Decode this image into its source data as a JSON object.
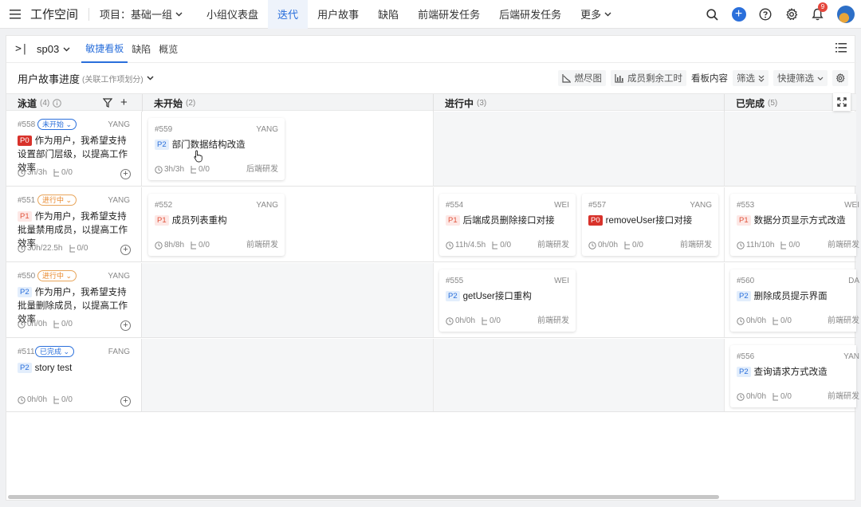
{
  "nav": {
    "workspace": "工作空间",
    "project": "项目：基础一组",
    "tabs": [
      {
        "label": "小组仪表盘"
      },
      {
        "label": "迭代"
      },
      {
        "label": "用户故事"
      },
      {
        "label": "缺陷"
      },
      {
        "label": "前端研发任务"
      },
      {
        "label": "后端研发任务"
      },
      {
        "label": "更多"
      }
    ],
    "active_tab": "迭代",
    "notification_count": "9"
  },
  "subbar": {
    "sprint": "sp03",
    "tabs": [
      {
        "label": "敏捷看板"
      },
      {
        "label": "缺陷"
      },
      {
        "label": "概览"
      }
    ],
    "active_tab": "敏捷看板"
  },
  "toolbar": {
    "title": "用户故事进度",
    "subtitle": "(关联工作项划分)",
    "burndown": "燃尽图",
    "remaining": "成员剩余工时",
    "board_content": "看板内容",
    "filter": "筛选",
    "quick_filter": "快捷筛选"
  },
  "board": {
    "lane_header": {
      "label": "泳道",
      "count": "(4)"
    },
    "columns": [
      {
        "label": "未开始",
        "count": "(2)"
      },
      {
        "label": "进行中",
        "count": "(3)"
      },
      {
        "label": "已完成",
        "count": "(5)"
      }
    ],
    "lanes": [
      {
        "id": "#558",
        "status": "未开始",
        "status_color": "#2a6fdb",
        "owner": "YANG",
        "prio": "P0",
        "title": "作为用户，我希望支持设置部门层级，以提高工作效率",
        "hours": "3h/3h",
        "sub": "0/0"
      },
      {
        "id": "#551",
        "status": "进行中",
        "status_color": "#e8872a",
        "owner": "YANG",
        "prio": "P1",
        "title": "作为用户，我希望支持批量禁用成员，以提高工作效率",
        "hours": "30h/22.5h",
        "sub": "0/0"
      },
      {
        "id": "#550",
        "status": "进行中",
        "status_color": "#e8872a",
        "owner": "YANG",
        "prio": "P2",
        "title": "作为用户，我希望支持批量删除成员，以提高工作效率",
        "hours": "0h/0h",
        "sub": "0/0"
      },
      {
        "id": "#511",
        "status": "已完成",
        "status_color": "#2a6fdb",
        "owner": "FANG",
        "prio": "P2",
        "title": "story test",
        "hours": "0h/0h",
        "sub": "0/0"
      }
    ],
    "cards": [
      {
        "id": "#559",
        "owner": "YANG",
        "prio": "P2",
        "title": "部门数据结构改造",
        "hours": "3h/3h",
        "sub": "0/0",
        "team": "后端研发"
      },
      {
        "id": "#552",
        "owner": "YANG",
        "prio": "P1",
        "title": "成员列表重构",
        "hours": "8h/8h",
        "sub": "0/0",
        "team": "前端研发"
      },
      {
        "id": "#554",
        "owner": "WEI",
        "prio": "P1",
        "title": "后端成员删除接口对接",
        "hours": "11h/4.5h",
        "sub": "0/0",
        "team": "前端研发"
      },
      {
        "id": "#557",
        "owner": "YANG",
        "prio": "P0",
        "title": "removeUser接口对接",
        "hours": "0h/0h",
        "sub": "0/0",
        "team": "前端研发"
      },
      {
        "id": "#553",
        "owner": "WEI",
        "prio": "P1",
        "title": "数据分页显示方式改造",
        "hours": "11h/10h",
        "sub": "0/0",
        "team": "前端研发"
      },
      {
        "id": "#555",
        "owner": "WEI",
        "prio": "P2",
        "title": "getUser接口重构",
        "hours": "0h/0h",
        "sub": "0/0",
        "team": "前端研发"
      },
      {
        "id": "#560",
        "owner": "DA",
        "prio": "P2",
        "title": "删除成员提示界面",
        "hours": "0h/0h",
        "sub": "0/0",
        "team": "前端研发"
      },
      {
        "id": "#556",
        "owner": "YAN",
        "prio": "P2",
        "title": "查询请求方式改造",
        "hours": "0h/0h",
        "sub": "0/0",
        "team": "前端研发"
      }
    ]
  }
}
